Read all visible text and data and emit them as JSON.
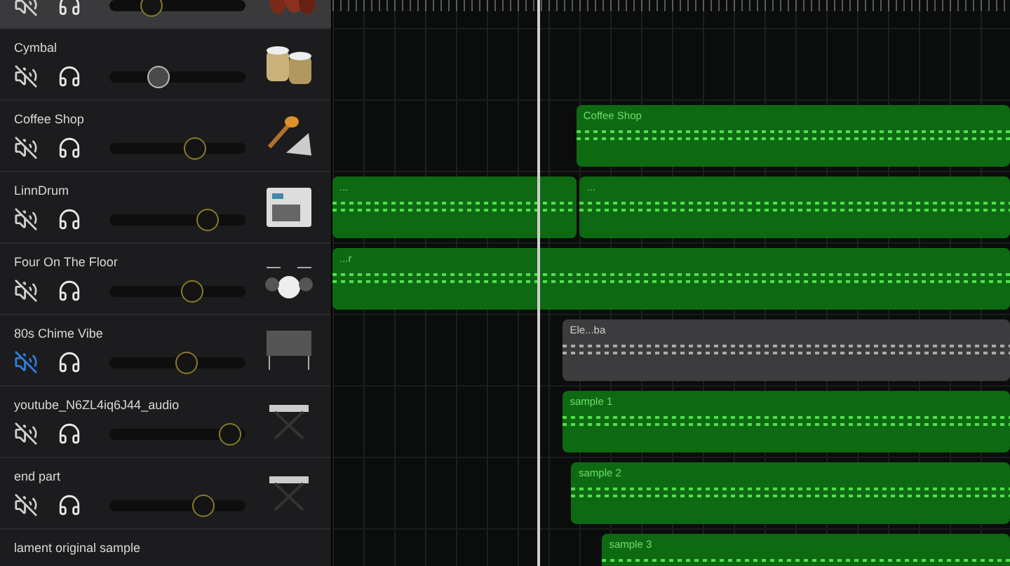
{
  "tracks": [
    {
      "selected": true,
      "muted": false,
      "level": 0.31,
      "thumb_active": false
    },
    {
      "name": "Cymbal",
      "selected": false,
      "muted": false,
      "level": 0.36,
      "thumb_active": true
    },
    {
      "name": "Coffee Shop",
      "selected": false,
      "muted": false,
      "level": 0.63,
      "thumb_active": false,
      "regions": [
        {
          "label": "Coffee Shop"
        }
      ]
    },
    {
      "name": "LinnDrum",
      "selected": false,
      "muted": false,
      "level": 0.72,
      "thumb_active": false,
      "regions": [
        {
          "label": "..."
        },
        {
          "label": "..."
        }
      ]
    },
    {
      "name": "Four On The Floor",
      "selected": false,
      "muted": false,
      "level": 0.61,
      "thumb_active": false,
      "regions": [
        {
          "label": "...r"
        }
      ]
    },
    {
      "name": "80s Chime Vibe",
      "selected": false,
      "muted": true,
      "level": 0.57,
      "thumb_active": false,
      "regions": [
        {
          "label": "Ele...ba"
        }
      ]
    },
    {
      "name": "youtube_N6ZL4iq6J44_audio",
      "selected": false,
      "muted": false,
      "level": 0.89,
      "thumb_active": false,
      "regions": [
        {
          "label": "sample 1"
        }
      ]
    },
    {
      "name": "end part",
      "selected": false,
      "muted": false,
      "level": 0.69,
      "thumb_active": false,
      "regions": [
        {
          "label": "sample 2"
        }
      ]
    },
    {
      "name": "lament original sample",
      "selected": false,
      "regions": [
        {
          "label": "sample 3"
        }
      ]
    }
  ]
}
